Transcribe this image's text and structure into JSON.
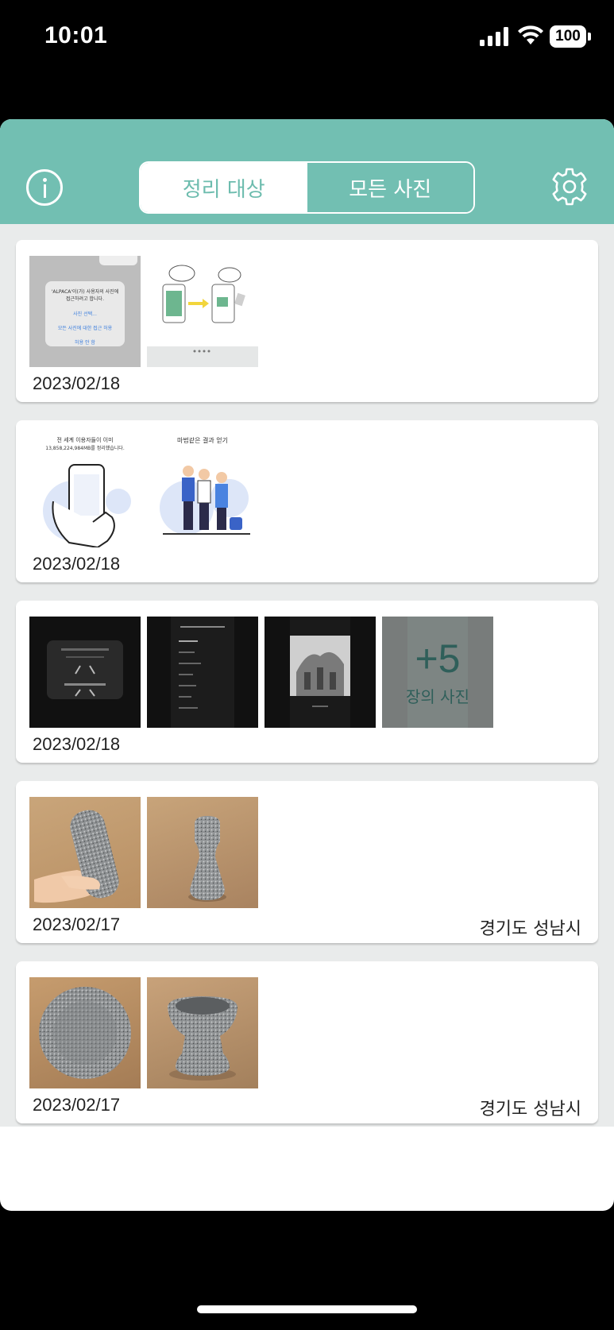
{
  "status_bar": {
    "time": "10:01",
    "battery": "100"
  },
  "header": {
    "tabs": [
      {
        "label": "정리 대상",
        "active": true
      },
      {
        "label": "모든 사진",
        "active": false
      }
    ],
    "accent_color": "#72bfb2"
  },
  "cards": [
    {
      "date": "2023/02/18",
      "location": "",
      "thumbnails": [
        {
          "type": "screenshot-permission-dialog",
          "text_lines": [
            "'ALPACA'이(가) 사용자의 사진에",
            "접근하려고 합니다.",
            "사진 선택...",
            "모든 사진에 대한 접근 허용",
            "허용 안 함"
          ]
        },
        {
          "type": "illustration-phones"
        }
      ]
    },
    {
      "date": "2023/02/18",
      "location": "",
      "thumbnails": [
        {
          "type": "illustration-hand-phone",
          "text_lines": [
            "전 세계 이용자들이 이미",
            "13,858,224,984MB를 정리했습니다."
          ]
        },
        {
          "type": "illustration-people",
          "text_lines": [
            "마법같은 결과 얻기"
          ]
        }
      ]
    },
    {
      "date": "2023/02/18",
      "location": "",
      "thumbnails": [
        {
          "type": "dark-screenshot-permission"
        },
        {
          "type": "dark-screenshot-albums"
        },
        {
          "type": "dark-screenshot-photo"
        },
        {
          "type": "dark-screenshot-more"
        }
      ],
      "more_overlay": {
        "count": "+5",
        "label": "장의 사진"
      }
    },
    {
      "date": "2023/02/17",
      "location": "경기도 성남시",
      "thumbnails": [
        {
          "type": "photo-stone-pestle-hand"
        },
        {
          "type": "photo-stone-pestle-standing"
        }
      ]
    },
    {
      "date": "2023/02/17",
      "location": "경기도 성남시",
      "thumbnails": [
        {
          "type": "photo-stone-mortar-top"
        },
        {
          "type": "photo-stone-mortar-side"
        }
      ]
    }
  ]
}
